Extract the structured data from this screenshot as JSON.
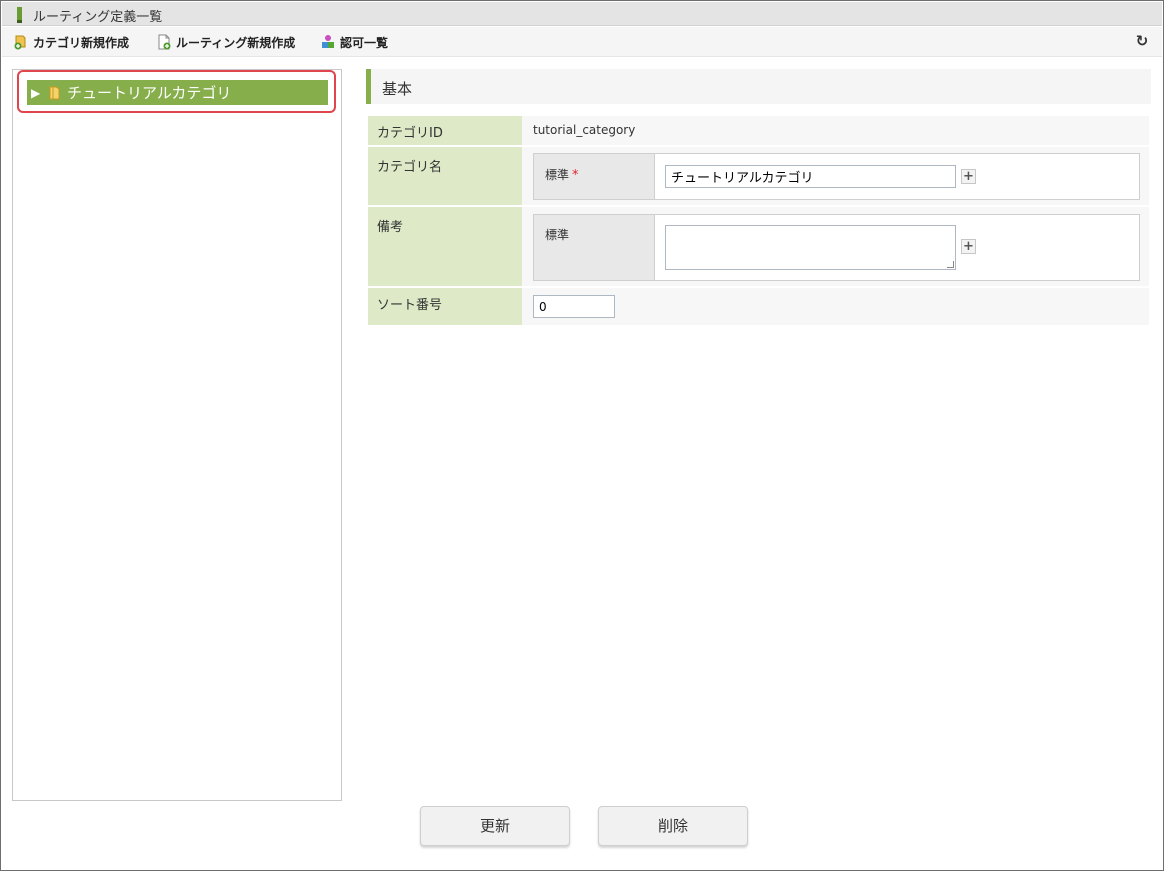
{
  "window": {
    "title": "ルーティング定義一覧"
  },
  "toolbar": {
    "items": [
      {
        "label": "カテゴリ新規作成",
        "icon": "add-category-icon"
      },
      {
        "label": "ルーティング新規作成",
        "icon": "add-document-icon"
      },
      {
        "label": "認可一覧",
        "icon": "users-icon"
      }
    ],
    "refresh_icon": "refresh-icon"
  },
  "tree": {
    "items": [
      {
        "label": "チュートリアルカテゴリ",
        "selected": true
      }
    ]
  },
  "form": {
    "section_title": "基本",
    "category_id": {
      "label": "カテゴリID",
      "value": "tutorial_category"
    },
    "category_name": {
      "label": "カテゴリ名",
      "locale_label": "標準",
      "required_mark": "*",
      "value": "チュートリアルカテゴリ",
      "add_button": "+"
    },
    "remarks": {
      "label": "備考",
      "locale_label": "標準",
      "value": "",
      "add_button": "+"
    },
    "sort_no": {
      "label": "ソート番号",
      "value": "0"
    }
  },
  "buttons": {
    "update": "更新",
    "delete": "削除"
  },
  "colors": {
    "accent_green": "#86ae4a",
    "label_bg": "#dde9c7",
    "highlight_red": "#e0454e"
  }
}
